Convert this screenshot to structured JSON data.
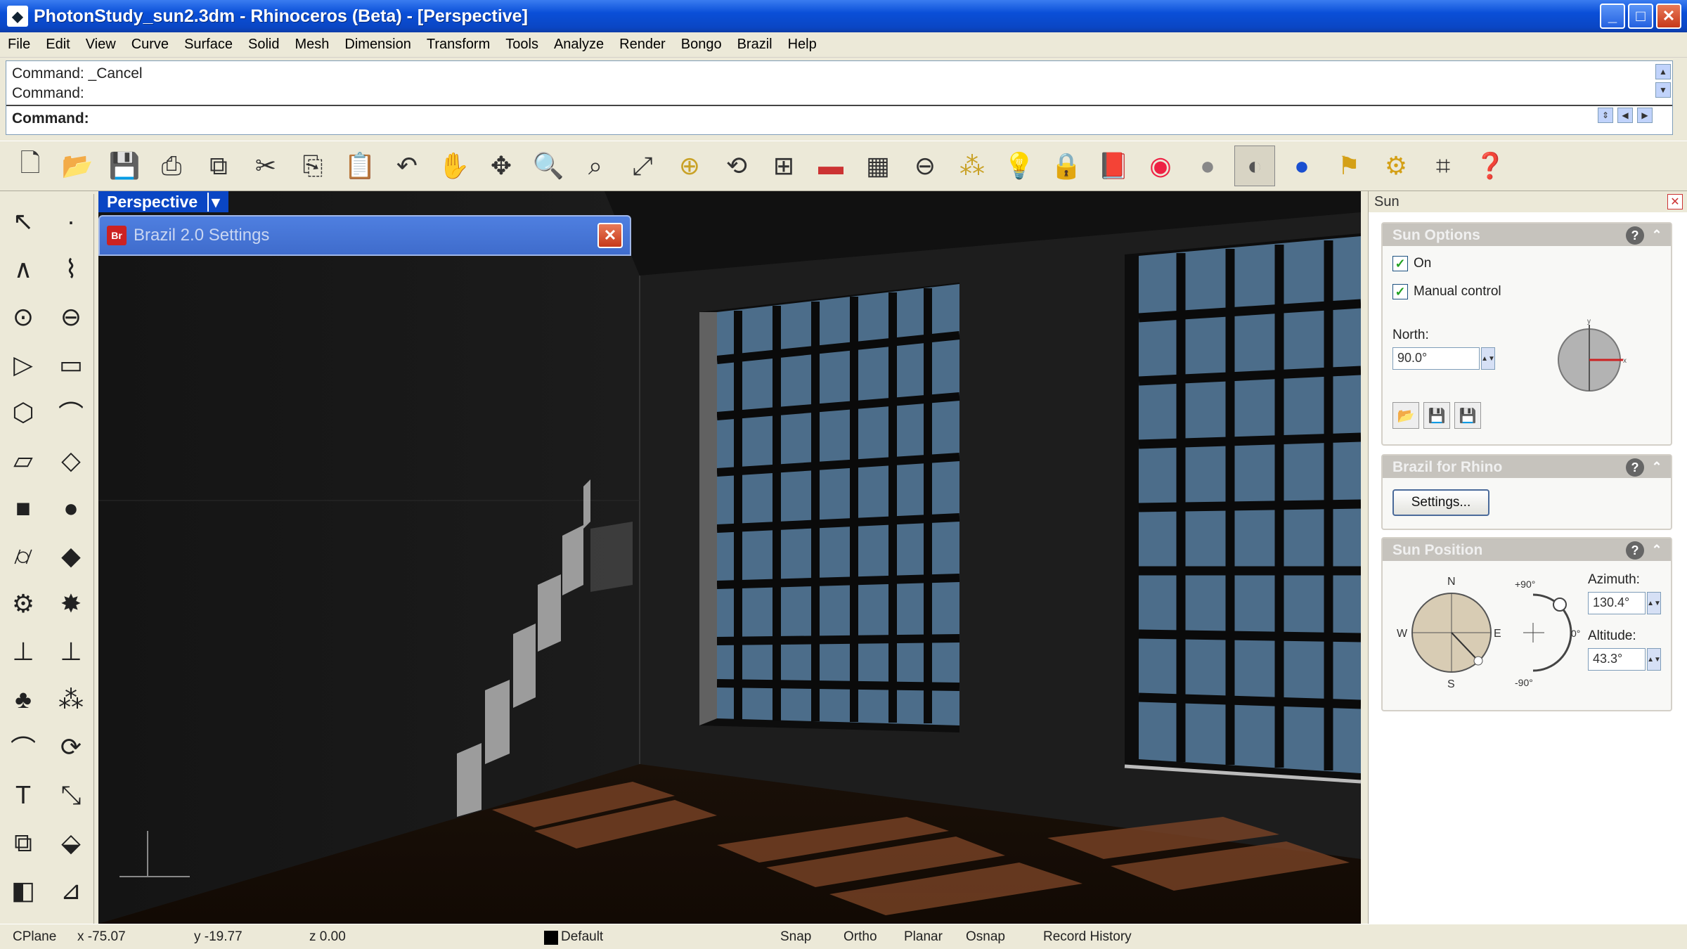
{
  "window": {
    "title": "PhotonStudy_sun2.3dm - Rhinoceros (Beta) - [Perspective]"
  },
  "menu": [
    "File",
    "Edit",
    "View",
    "Curve",
    "Surface",
    "Solid",
    "Mesh",
    "Dimension",
    "Transform",
    "Tools",
    "Analyze",
    "Render",
    "Bongo",
    "Brazil",
    "Help"
  ],
  "command": {
    "history": [
      "Command: _Cancel",
      "Command:"
    ],
    "prompt": "Command:"
  },
  "viewport": {
    "label": "Perspective",
    "dropdown": "▾"
  },
  "dialog": {
    "title": "Brazil 2.0 Settings",
    "icon_text": "Br"
  },
  "sidepanel": {
    "title": "Sun",
    "sun_options": {
      "header": "Sun Options",
      "on_label": "On",
      "manual_label": "Manual control",
      "north_label": "North:",
      "north_value": "90.0°"
    },
    "brazil": {
      "header": "Brazil for Rhino",
      "settings_button": "Settings..."
    },
    "sun_position": {
      "header": "Sun Position",
      "azimuth_label": "Azimuth:",
      "azimuth_value": "130.4°",
      "altitude_label": "Altitude:",
      "altitude_value": "43.3°",
      "compass": {
        "n": "N",
        "s": "S",
        "e": "E",
        "w": "W"
      },
      "arc": {
        "top": "+90°",
        "bottom": "-90°",
        "mid": "0°"
      }
    }
  },
  "status": {
    "cplane": "CPlane",
    "x": "x -75.07",
    "y": "y -19.77",
    "z": "z 0.00",
    "layer": "Default",
    "snap": "Snap",
    "ortho": "Ortho",
    "planar": "Planar",
    "osnap": "Osnap",
    "history": "Record History"
  }
}
